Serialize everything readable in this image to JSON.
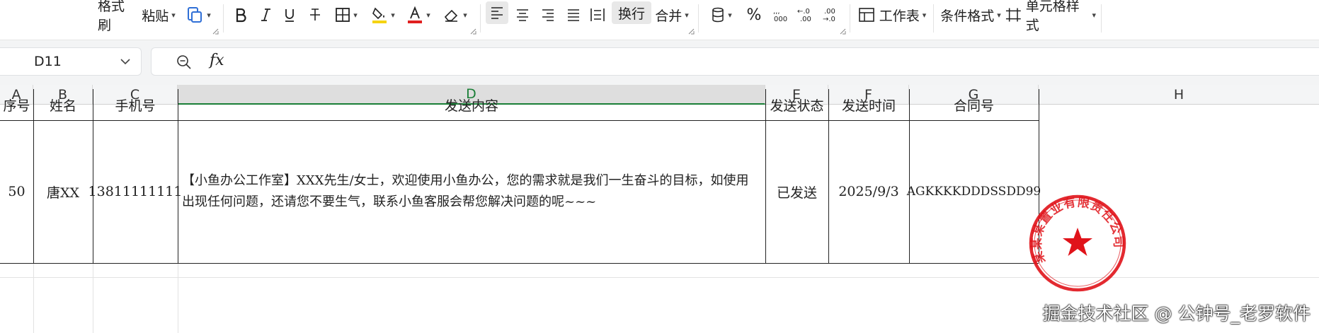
{
  "toolbar": {
    "format_painter": "格式刷",
    "paste": "粘贴",
    "wrap": "换行",
    "merge": "合并",
    "percent": "%",
    "worksheet": "工作表",
    "conditional_format": "条件格式",
    "cell_style": "单元格样式",
    "highlight_color": "#f5d311",
    "font_color": "#e02020"
  },
  "formula_bar": {
    "name_box": "D11",
    "fx": "fx",
    "value": ""
  },
  "columns": [
    "A",
    "B",
    "C",
    "D",
    "E",
    "F",
    "G",
    "H"
  ],
  "selected_column": "D",
  "table": {
    "headers": [
      "序号",
      "姓名",
      "手机号",
      "发送内容",
      "发送状态",
      "发送时间",
      "合同号"
    ],
    "row": {
      "seq": "50",
      "name": "唐XX",
      "phone": "13811111111",
      "content": "【小鱼办公工作室】XXX先生/女士，欢迎使用小鱼办公，您的需求就是我们一生奋斗的目标，如使用出现任何问题，还请您不要生气，联系小鱼客服会帮您解决问题的呢~~~",
      "status": "已发送",
      "time": "2025/9/3",
      "contract": "AGKKKKDDDSSDD99"
    }
  },
  "stamp": {
    "text": "某某某置业有限责任公司",
    "color": "#e0131a"
  },
  "watermark": "掘金技术社区 @ 公钟号_老罗软件"
}
